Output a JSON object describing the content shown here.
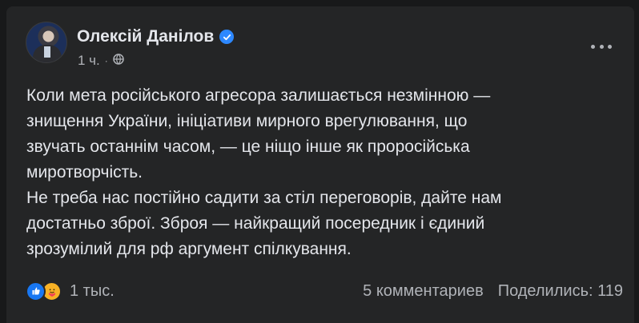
{
  "post": {
    "author": "Олексій Данілов",
    "time": "1 ч.",
    "separator": "·",
    "text": "Коли мета російського агресора залишається незмінною —\nзнищення України, ініціативи мирного врегулювання, що\nзвучать останнім часом, — це ніщо інше як проросійська\nмиротворчість.\nНе треба нас постійно садити за стіл переговорів, дайте нам\nдостатньо зброї. Зброя — найкращий посередник і єдиний\nзрозумілий для рф аргумент спілкування."
  },
  "icons": {
    "verified": "verified-badge-icon",
    "audience": "globe-icon",
    "more": "more-options-icon",
    "reaction_1": "like-reaction-icon",
    "reaction_2": "care-reaction-icon"
  },
  "stats": {
    "reactions": "1 тыс.",
    "comments": "5 комментариев",
    "shares": "Поделились: 119"
  },
  "colors": {
    "background": "#18191a",
    "card": "#242526",
    "text": "#e4e6eb",
    "secondary_text": "#b0b3b8",
    "accent": "#2d88ff",
    "like": "#1877f2",
    "care": "#f7b125"
  }
}
